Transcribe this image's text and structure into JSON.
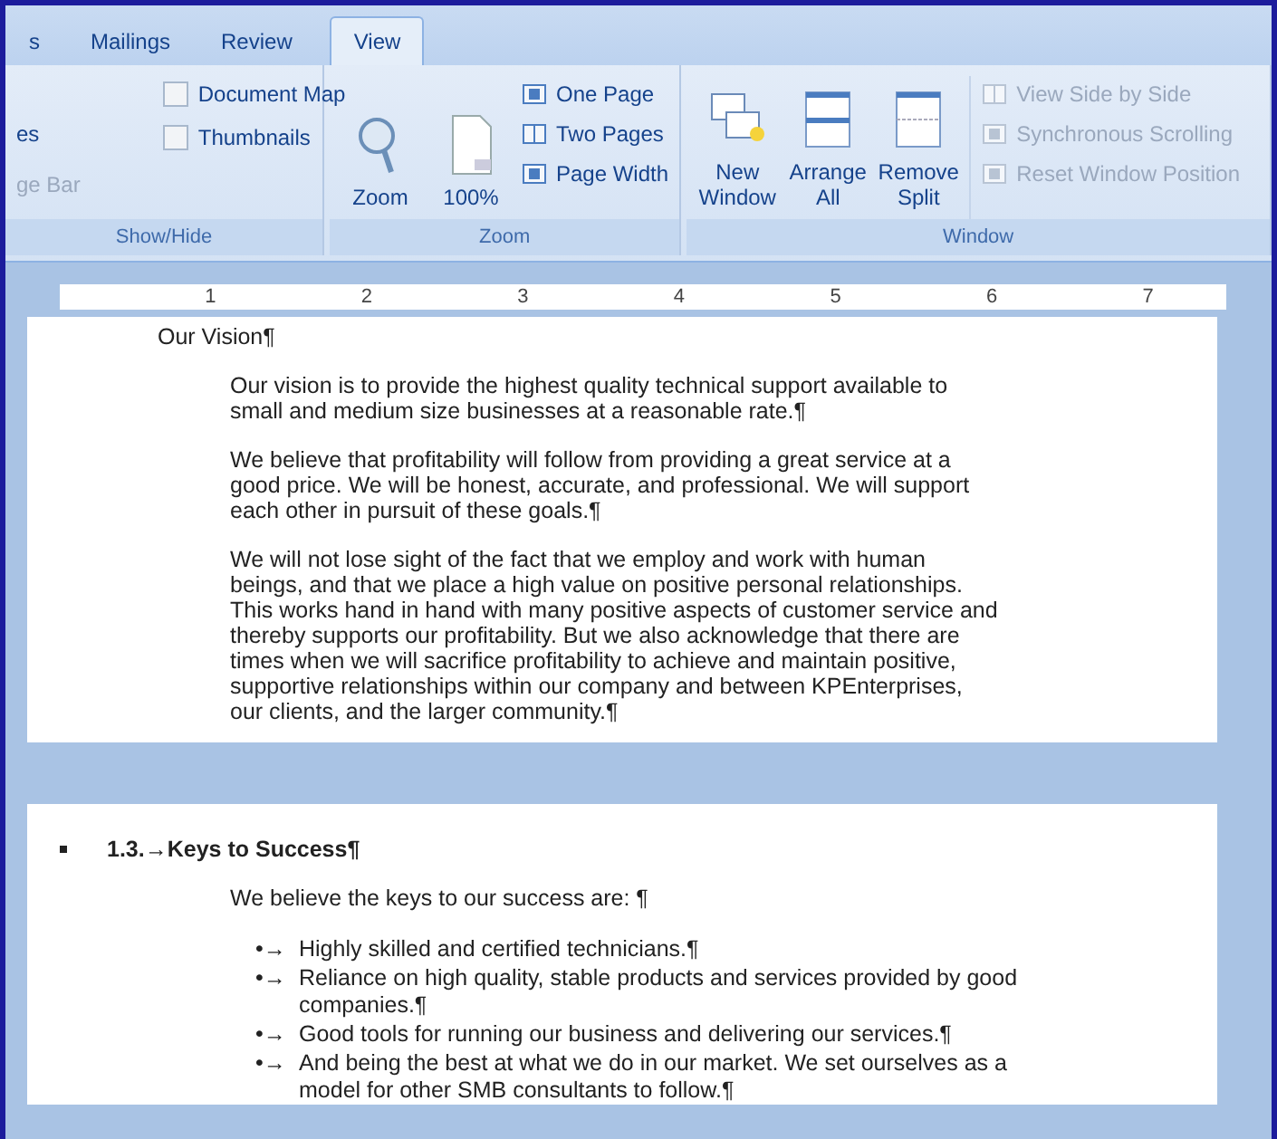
{
  "tabs": [
    {
      "label": "s",
      "selected": false
    },
    {
      "label": "Mailings",
      "selected": false
    },
    {
      "label": "Review",
      "selected": false
    },
    {
      "label": "View",
      "selected": true
    }
  ],
  "ribbon": {
    "groups": [
      {
        "kind": "showhide",
        "label": "Show/Hide",
        "partial_items": [
          {
            "label": "es",
            "disabled": false
          },
          {
            "label": "ge Bar",
            "disabled": true
          }
        ],
        "checkboxes": [
          {
            "label": "Document Map",
            "checked": false
          },
          {
            "label": "Thumbnails",
            "checked": false
          }
        ]
      },
      {
        "kind": "zoom",
        "label": "Zoom",
        "large_buttons": [
          {
            "label": "Zoom"
          },
          {
            "label": "100%"
          }
        ],
        "small_buttons": [
          {
            "label": "One Page"
          },
          {
            "label": "Two Pages"
          },
          {
            "label": "Page Width"
          }
        ]
      },
      {
        "kind": "window",
        "label": "Window",
        "large_buttons": [
          {
            "label": "New Window"
          },
          {
            "label": "Arrange All"
          },
          {
            "label": "Remove Split"
          }
        ],
        "small_buttons": [
          {
            "label": "View Side by Side",
            "disabled": true
          },
          {
            "label": "Synchronous Scrolling",
            "disabled": true
          },
          {
            "label": "Reset Window Position",
            "disabled": true
          }
        ]
      }
    ]
  },
  "ruler": {
    "numbers": [
      "1",
      "2",
      "3",
      "4",
      "5",
      "6",
      "7"
    ]
  },
  "page_1": {
    "heading": "Our Vision¶",
    "paragraphs": [
      "Our vision is to provide the highest quality technical support available to small and medium size businesses at a reasonable rate.¶",
      "We believe that profitability will follow from providing a great service at a good price. We will be honest, accurate, and professional. We will support each other in pursuit of these goals.¶",
      "We will not lose sight of the fact that we employ and work with human beings, and that we place a high value on positive personal relationships. This works hand in hand with many positive aspects of customer service and thereby supports our profitability. But we also acknowledge that there are times when we will sacrifice profitability to achieve and maintain positive, supportive relationships within our company and between KPEnterprises, our clients, and the larger community.¶"
    ]
  },
  "page_2": {
    "heading": "1.3.→Keys to Success¶",
    "intro": "We believe the keys to our success are: ¶",
    "bullets": [
      {
        "marker": "•→",
        "text": "Highly skilled and certified technicians.¶"
      },
      {
        "marker": "•→",
        "text": "Reliance on high quality, stable products and services provided by good companies.¶"
      },
      {
        "marker": "•→",
        "text": "Good tools for running our business and delivering our services.¶"
      },
      {
        "marker": "•→",
        "text": "And being the best at what we do in our market. We set ourselves as a model for other SMB consultants to follow.¶"
      }
    ]
  }
}
